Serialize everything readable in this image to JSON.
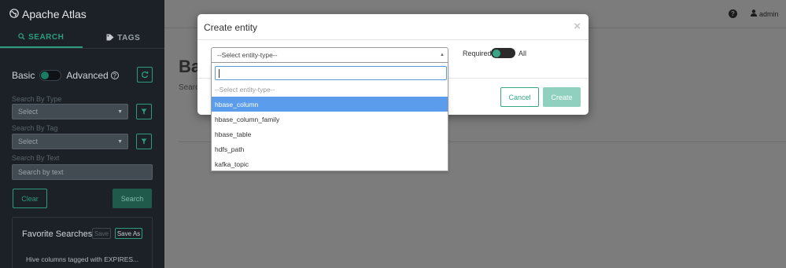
{
  "app": {
    "name": "Apache Atlas",
    "logo_icon": "globe-icon"
  },
  "sidebar": {
    "tabs": [
      {
        "label": "SEARCH",
        "icon": "search-icon",
        "active": true
      },
      {
        "label": "TAGS",
        "icon": "tag-icon",
        "active": false
      }
    ],
    "mode": {
      "basic_label": "Basic",
      "advanced_label": "Advanced"
    },
    "search_by_type": {
      "label": "Search By Type",
      "value": "Select"
    },
    "search_by_tag": {
      "label": "Search By Tag",
      "value": "Select"
    },
    "search_by_text": {
      "label": "Search By Text",
      "placeholder": "Search by text"
    },
    "clear_label": "Clear",
    "search_label": "Search",
    "favorites": {
      "title": "Favorite Searches",
      "save_label": "Save",
      "save_as_label": "Save As",
      "items": [
        "Hive columns tagged with EXPIRES..."
      ]
    }
  },
  "main": {
    "title": "Ba",
    "subtitle": "Search",
    "user": {
      "name": "admin",
      "icon": "user-icon"
    },
    "help_icon": "question-circle-icon"
  },
  "modal": {
    "title": "Create entity",
    "close_glyph": "×",
    "entity_select": {
      "selected": "--Select entity-type--"
    },
    "required_label": "Required",
    "all_label": "All",
    "cancel_label": "Cancel",
    "create_label": "Create",
    "dropdown": {
      "search_value": "",
      "options": [
        {
          "label": "--Select entity-type--",
          "type": "placeholder"
        },
        {
          "label": "hbase_column",
          "type": "highlight"
        },
        {
          "label": "hbase_column_family",
          "type": "normal"
        },
        {
          "label": "hbase_table",
          "type": "normal"
        },
        {
          "label": "hdfs_path",
          "type": "normal"
        },
        {
          "label": "kafka_topic",
          "type": "normal"
        }
      ]
    }
  },
  "colors": {
    "accent": "#37a586",
    "sidebar_bg": "#1b2127",
    "highlight": "#5c9cec",
    "overlay": "#7c7c7c"
  }
}
